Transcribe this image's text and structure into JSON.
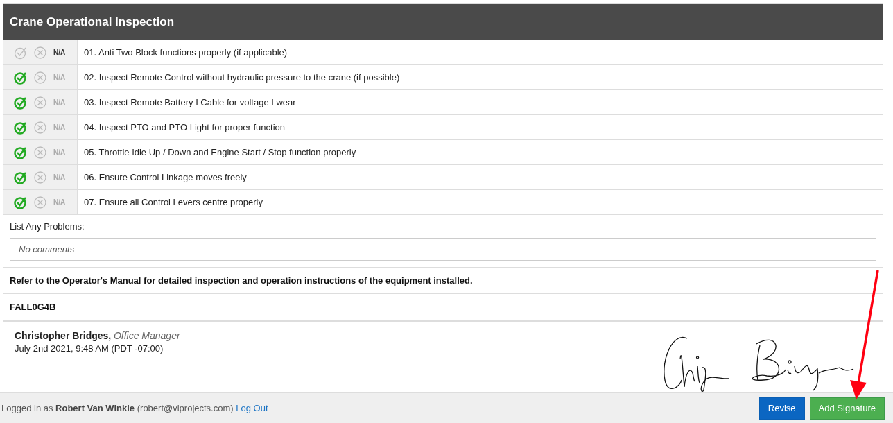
{
  "section": {
    "title": "Crane Operational Inspection"
  },
  "items": [
    {
      "pass_selected": false,
      "fail_selected": false,
      "na_selected": true,
      "na_label": "N/A",
      "text": "01. Anti Two Block functions properly (if applicable)"
    },
    {
      "pass_selected": true,
      "fail_selected": false,
      "na_selected": false,
      "na_label": "N/A",
      "text": "02. Inspect Remote Control without hydraulic pressure to the crane (if possible)"
    },
    {
      "pass_selected": true,
      "fail_selected": false,
      "na_selected": false,
      "na_label": "N/A",
      "text": "03. Inspect Remote Battery I Cable for voltage I wear"
    },
    {
      "pass_selected": true,
      "fail_selected": false,
      "na_selected": false,
      "na_label": "N/A",
      "text": "04. Inspect PTO and PTO Light for proper function"
    },
    {
      "pass_selected": true,
      "fail_selected": false,
      "na_selected": false,
      "na_label": "N/A",
      "text": "05. Throttle Idle Up / Down and Engine Start / Stop function properly"
    },
    {
      "pass_selected": true,
      "fail_selected": false,
      "na_selected": false,
      "na_label": "N/A",
      "text": "06. Ensure Control Linkage moves freely"
    },
    {
      "pass_selected": true,
      "fail_selected": false,
      "na_selected": false,
      "na_label": "N/A",
      "text": "07. Ensure all Control Levers centre properly"
    }
  ],
  "problems": {
    "label": "List Any Problems:",
    "value": "No comments"
  },
  "note": "Refer to the Operator's Manual for detailed inspection and operation instructions of the equipment installed.",
  "code": "FALL0G4B",
  "signature": {
    "name": "Christopher Bridges,",
    "role": "Office Manager",
    "date": "July 2nd 2021, 9:48 AM (PDT -07:00)"
  },
  "footer": {
    "status": "Logged in as **Robert Van Winkle** (robert@viprojects.com)",
    "logout": "Log Out",
    "buttons": [
      {
        "kind": "primary",
        "label": "Revise"
      },
      {
        "kind": "success",
        "label": "Add Signature"
      }
    ]
  }
}
